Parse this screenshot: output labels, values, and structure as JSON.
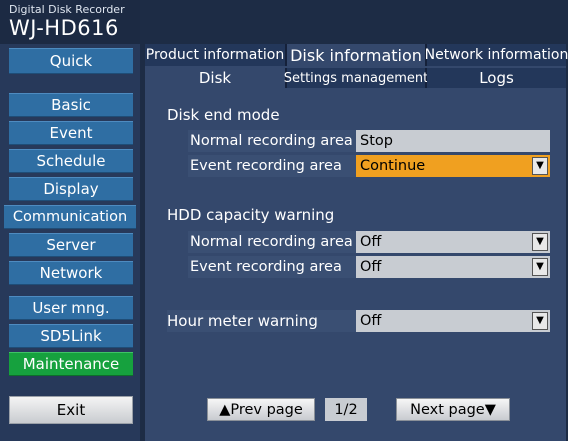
{
  "header": {
    "subtitle": "Digital Disk Recorder",
    "model": "WJ-HD616"
  },
  "nav": {
    "quick": "Quick",
    "items": [
      {
        "label": "Basic"
      },
      {
        "label": "Event"
      },
      {
        "label": "Schedule"
      },
      {
        "label": "Display"
      },
      {
        "label": "Communication"
      },
      {
        "label": "Server"
      },
      {
        "label": "Network"
      },
      {
        "label": "User mng."
      },
      {
        "label": "SD5Link"
      },
      {
        "label": "Maintenance"
      }
    ],
    "active": "Maintenance",
    "exit": "Exit"
  },
  "tabs_primary": [
    {
      "label": "Product information",
      "active": false
    },
    {
      "label": "Disk information",
      "active": true
    },
    {
      "label": "Network information",
      "active": false
    }
  ],
  "tabs_secondary": [
    {
      "label": "Disk",
      "active": true
    },
    {
      "label": "Settings management",
      "active": false
    },
    {
      "label": "Logs",
      "active": false
    }
  ],
  "disk_end_mode": {
    "title": "Disk end mode",
    "normal_label": "Normal recording area",
    "normal_value": "Stop",
    "event_label": "Event recording area",
    "event_value": "Continue"
  },
  "hdd_warning": {
    "title": "HDD capacity warning",
    "normal_label": "Normal recording area",
    "normal_value": "Off",
    "event_label": "Event recording area",
    "event_value": "Off"
  },
  "hour_meter": {
    "label": "Hour meter warning",
    "value": "Off"
  },
  "pager": {
    "prev": "▲Prev page",
    "indicator": "1/2",
    "next": "Next page▼"
  },
  "icons": {
    "dropdown": "down-triangle",
    "highlight": "#f0a020",
    "active_nav": "#16a13e",
    "nav_button": "#2f6ea3"
  }
}
